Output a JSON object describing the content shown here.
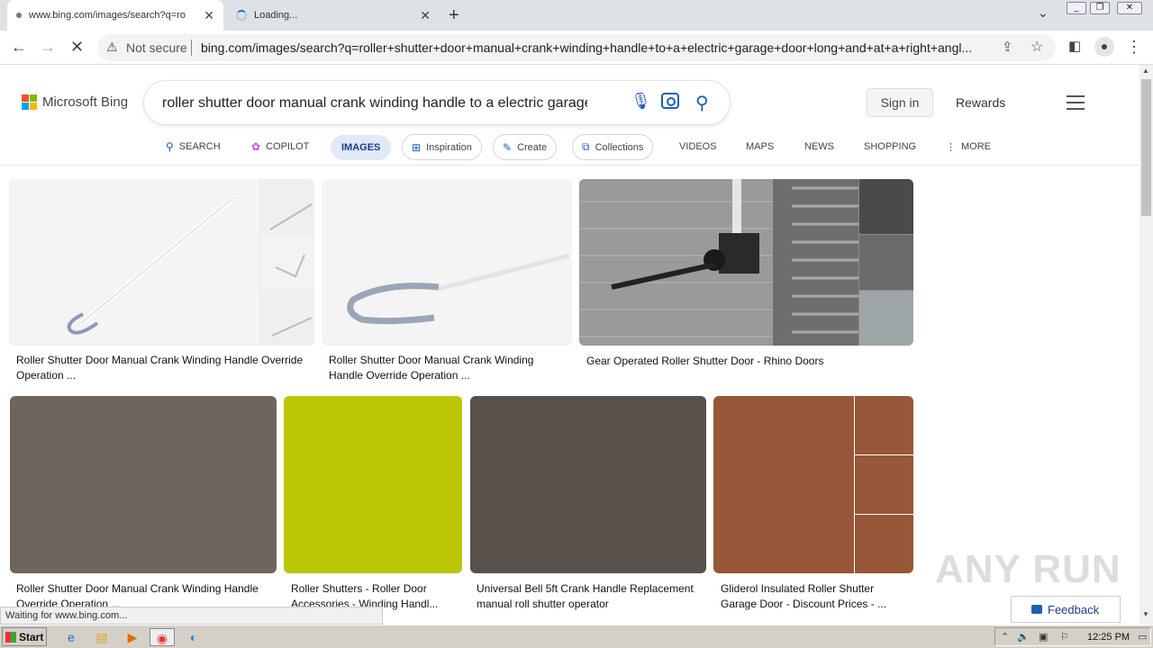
{
  "browser": {
    "tabs": [
      {
        "title": "www.bing.com/images/search?q=ro",
        "state": "loading-dot"
      },
      {
        "title": "Loading...",
        "state": "spinner"
      }
    ],
    "new_tab": "+",
    "window_buttons": {
      "minimize": "_",
      "restore": "❐",
      "close": "✕"
    },
    "nav": {
      "back": "←",
      "forward": "→",
      "stop": "✕"
    },
    "security_label": "Not secure",
    "url": "bing.com/images/search?q=roller+shutter+door+manual+crank+winding+handle+to+a+electric+garage+door+long+and+at+a+right+angl..."
  },
  "bing": {
    "logo_text": "Microsoft Bing",
    "logo_colors": [
      "#f25022",
      "#7fba00",
      "#00a4ef",
      "#ffb900"
    ],
    "search_value": "roller shutter door manual crank winding handle to a electric garage c",
    "sign_in": "Sign in",
    "rewards": "Rewards",
    "scopes": {
      "search": "SEARCH",
      "copilot": "COPILOT",
      "images": "IMAGES",
      "inspiration": "Inspiration",
      "create": "Create",
      "collections": "Collections",
      "videos": "VIDEOS",
      "maps": "MAPS",
      "news": "NEWS",
      "shopping": "SHOPPING",
      "more": "MORE"
    }
  },
  "results": [
    {
      "caption": "Roller Shutter Door Manual Crank Winding Handle Override Operation ..."
    },
    {
      "caption": "Roller Shutter Door Manual Crank Winding Handle Override Operation ..."
    },
    {
      "caption": "Gear Operated Roller Shutter Door - Rhino Doors"
    },
    {
      "caption": "Roller Shutter Door Manual Crank Winding Handle Override Operation ...",
      "color": "#6e665d"
    },
    {
      "caption": "Roller Shutters - Roller Door Accessories - Winding Handl...",
      "color": "#bbc607"
    },
    {
      "caption": "Universal Bell 5ft Crank Handle Replacement manual roll shutter operator",
      "color": "#58504a"
    },
    {
      "caption": "Gliderol Insulated Roller Shutter Garage Door - Discount Prices - ...",
      "color": "#975738"
    }
  ],
  "status": "Waiting for www.bing.com...",
  "feedback": "Feedback",
  "watermark": "ANY RUN",
  "taskbar": {
    "start": "Start",
    "clock": "12:25 PM"
  }
}
